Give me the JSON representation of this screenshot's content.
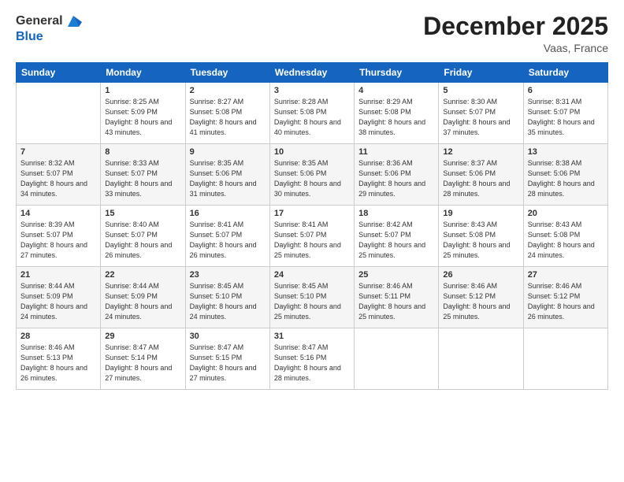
{
  "logo": {
    "general": "General",
    "blue": "Blue"
  },
  "header": {
    "month": "December 2025",
    "location": "Vaas, France"
  },
  "weekdays": [
    "Sunday",
    "Monday",
    "Tuesday",
    "Wednesday",
    "Thursday",
    "Friday",
    "Saturday"
  ],
  "weeks": [
    [
      {
        "day": "",
        "sunrise": "",
        "sunset": "",
        "daylight": ""
      },
      {
        "day": "1",
        "sunrise": "Sunrise: 8:25 AM",
        "sunset": "Sunset: 5:09 PM",
        "daylight": "Daylight: 8 hours and 43 minutes."
      },
      {
        "day": "2",
        "sunrise": "Sunrise: 8:27 AM",
        "sunset": "Sunset: 5:08 PM",
        "daylight": "Daylight: 8 hours and 41 minutes."
      },
      {
        "day": "3",
        "sunrise": "Sunrise: 8:28 AM",
        "sunset": "Sunset: 5:08 PM",
        "daylight": "Daylight: 8 hours and 40 minutes."
      },
      {
        "day": "4",
        "sunrise": "Sunrise: 8:29 AM",
        "sunset": "Sunset: 5:08 PM",
        "daylight": "Daylight: 8 hours and 38 minutes."
      },
      {
        "day": "5",
        "sunrise": "Sunrise: 8:30 AM",
        "sunset": "Sunset: 5:07 PM",
        "daylight": "Daylight: 8 hours and 37 minutes."
      },
      {
        "day": "6",
        "sunrise": "Sunrise: 8:31 AM",
        "sunset": "Sunset: 5:07 PM",
        "daylight": "Daylight: 8 hours and 35 minutes."
      }
    ],
    [
      {
        "day": "7",
        "sunrise": "Sunrise: 8:32 AM",
        "sunset": "Sunset: 5:07 PM",
        "daylight": "Daylight: 8 hours and 34 minutes."
      },
      {
        "day": "8",
        "sunrise": "Sunrise: 8:33 AM",
        "sunset": "Sunset: 5:07 PM",
        "daylight": "Daylight: 8 hours and 33 minutes."
      },
      {
        "day": "9",
        "sunrise": "Sunrise: 8:35 AM",
        "sunset": "Sunset: 5:06 PM",
        "daylight": "Daylight: 8 hours and 31 minutes."
      },
      {
        "day": "10",
        "sunrise": "Sunrise: 8:35 AM",
        "sunset": "Sunset: 5:06 PM",
        "daylight": "Daylight: 8 hours and 30 minutes."
      },
      {
        "day": "11",
        "sunrise": "Sunrise: 8:36 AM",
        "sunset": "Sunset: 5:06 PM",
        "daylight": "Daylight: 8 hours and 29 minutes."
      },
      {
        "day": "12",
        "sunrise": "Sunrise: 8:37 AM",
        "sunset": "Sunset: 5:06 PM",
        "daylight": "Daylight: 8 hours and 28 minutes."
      },
      {
        "day": "13",
        "sunrise": "Sunrise: 8:38 AM",
        "sunset": "Sunset: 5:06 PM",
        "daylight": "Daylight: 8 hours and 28 minutes."
      }
    ],
    [
      {
        "day": "14",
        "sunrise": "Sunrise: 8:39 AM",
        "sunset": "Sunset: 5:07 PM",
        "daylight": "Daylight: 8 hours and 27 minutes."
      },
      {
        "day": "15",
        "sunrise": "Sunrise: 8:40 AM",
        "sunset": "Sunset: 5:07 PM",
        "daylight": "Daylight: 8 hours and 26 minutes."
      },
      {
        "day": "16",
        "sunrise": "Sunrise: 8:41 AM",
        "sunset": "Sunset: 5:07 PM",
        "daylight": "Daylight: 8 hours and 26 minutes."
      },
      {
        "day": "17",
        "sunrise": "Sunrise: 8:41 AM",
        "sunset": "Sunset: 5:07 PM",
        "daylight": "Daylight: 8 hours and 25 minutes."
      },
      {
        "day": "18",
        "sunrise": "Sunrise: 8:42 AM",
        "sunset": "Sunset: 5:07 PM",
        "daylight": "Daylight: 8 hours and 25 minutes."
      },
      {
        "day": "19",
        "sunrise": "Sunrise: 8:43 AM",
        "sunset": "Sunset: 5:08 PM",
        "daylight": "Daylight: 8 hours and 25 minutes."
      },
      {
        "day": "20",
        "sunrise": "Sunrise: 8:43 AM",
        "sunset": "Sunset: 5:08 PM",
        "daylight": "Daylight: 8 hours and 24 minutes."
      }
    ],
    [
      {
        "day": "21",
        "sunrise": "Sunrise: 8:44 AM",
        "sunset": "Sunset: 5:09 PM",
        "daylight": "Daylight: 8 hours and 24 minutes."
      },
      {
        "day": "22",
        "sunrise": "Sunrise: 8:44 AM",
        "sunset": "Sunset: 5:09 PM",
        "daylight": "Daylight: 8 hours and 24 minutes."
      },
      {
        "day": "23",
        "sunrise": "Sunrise: 8:45 AM",
        "sunset": "Sunset: 5:10 PM",
        "daylight": "Daylight: 8 hours and 24 minutes."
      },
      {
        "day": "24",
        "sunrise": "Sunrise: 8:45 AM",
        "sunset": "Sunset: 5:10 PM",
        "daylight": "Daylight: 8 hours and 25 minutes."
      },
      {
        "day": "25",
        "sunrise": "Sunrise: 8:46 AM",
        "sunset": "Sunset: 5:11 PM",
        "daylight": "Daylight: 8 hours and 25 minutes."
      },
      {
        "day": "26",
        "sunrise": "Sunrise: 8:46 AM",
        "sunset": "Sunset: 5:12 PM",
        "daylight": "Daylight: 8 hours and 25 minutes."
      },
      {
        "day": "27",
        "sunrise": "Sunrise: 8:46 AM",
        "sunset": "Sunset: 5:12 PM",
        "daylight": "Daylight: 8 hours and 26 minutes."
      }
    ],
    [
      {
        "day": "28",
        "sunrise": "Sunrise: 8:46 AM",
        "sunset": "Sunset: 5:13 PM",
        "daylight": "Daylight: 8 hours and 26 minutes."
      },
      {
        "day": "29",
        "sunrise": "Sunrise: 8:47 AM",
        "sunset": "Sunset: 5:14 PM",
        "daylight": "Daylight: 8 hours and 27 minutes."
      },
      {
        "day": "30",
        "sunrise": "Sunrise: 8:47 AM",
        "sunset": "Sunset: 5:15 PM",
        "daylight": "Daylight: 8 hours and 27 minutes."
      },
      {
        "day": "31",
        "sunrise": "Sunrise: 8:47 AM",
        "sunset": "Sunset: 5:16 PM",
        "daylight": "Daylight: 8 hours and 28 minutes."
      },
      {
        "day": "",
        "sunrise": "",
        "sunset": "",
        "daylight": ""
      },
      {
        "day": "",
        "sunrise": "",
        "sunset": "",
        "daylight": ""
      },
      {
        "day": "",
        "sunrise": "",
        "sunset": "",
        "daylight": ""
      }
    ]
  ]
}
